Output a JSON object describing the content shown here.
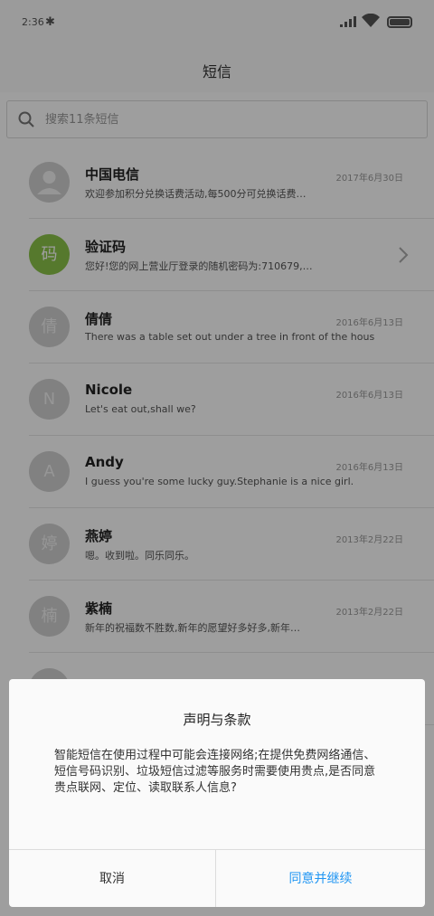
{
  "status": {
    "time": "2:36",
    "bluetooth_icon": "bluetooth-icon",
    "signal_icon": "signal-icon",
    "wifi_icon": "wifi-icon",
    "battery_icon": "battery-icon"
  },
  "header": {
    "title": "短信"
  },
  "search": {
    "placeholder": "搜索11条短信"
  },
  "conversations": [
    {
      "avatar": "",
      "avatar_type": "person-icon",
      "name": "中国电信",
      "date": "2017年6月30日",
      "preview": "欢迎参加积分兑换话费活动,每500分可兑换话费…"
    },
    {
      "avatar": "码",
      "avatar_color": "#8bc34a",
      "name": "验证码",
      "date": "",
      "preview": "您好!您的网上营业厅登录的随机密码为:710679,…"
    },
    {
      "avatar": "倩",
      "name": "倩倩",
      "date": "2016年6月13日",
      "preview": "There was a table set out under a tree in front of the hous"
    },
    {
      "avatar": "N",
      "name": "Nicole",
      "date": "2016年6月13日",
      "preview": "Let's eat out,shall we?"
    },
    {
      "avatar": "A",
      "name": "Andy",
      "date": "2016年6月13日",
      "preview": "I guess you're some lucky guy.Stephanie is a nice girl."
    },
    {
      "avatar": "婷",
      "name": "燕婷",
      "date": "2013年2月22日",
      "preview": "嗯。收到啦。同乐同乐。"
    },
    {
      "avatar": "楠",
      "name": "紫楠",
      "date": "2013年2月22日",
      "preview": "新年的祝福数不胜数,新年的愿望好多好多,新年…"
    },
    {
      "avatar": "",
      "name": "",
      "date": "",
      "preview": ""
    }
  ],
  "dialog": {
    "title": "声明与条款",
    "body": "智能短信在使用过程中可能会连接网络;在提供免费网络通信、短信号码识别、垃圾短信过滤等服务时需要使用贵点,是否同意贵点联网、定位、读取联系人信息?",
    "cancel_label": "取消",
    "agree_label": "同意并继续",
    "agree_color": "#2196f3"
  }
}
